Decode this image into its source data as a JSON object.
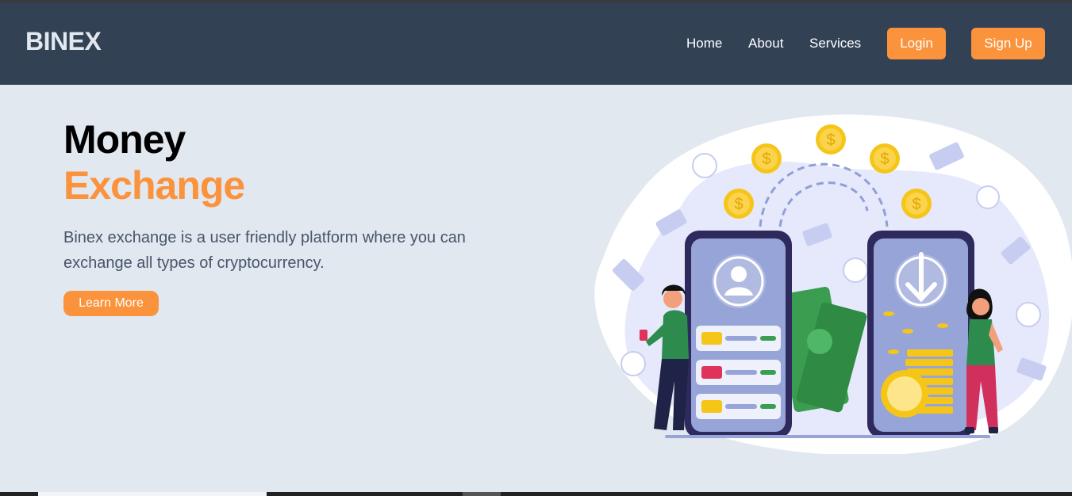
{
  "header": {
    "logo": "BINEX",
    "nav": [
      "Home",
      "About",
      "Services"
    ],
    "login": "Login",
    "signup": "Sign Up"
  },
  "hero": {
    "title_line1": "Money",
    "title_line2": "Exchange",
    "description": "Binex exchange is a user friendly platform where you can exchange all types of cryptocurrency.",
    "cta": "Learn More",
    "illustration": "money-exchange-illustration",
    "coin_symbol": "$"
  },
  "colors": {
    "header_bg": "#334155",
    "page_bg": "#e2e8f0",
    "accent": "#fb923c",
    "text_muted": "#475569"
  }
}
